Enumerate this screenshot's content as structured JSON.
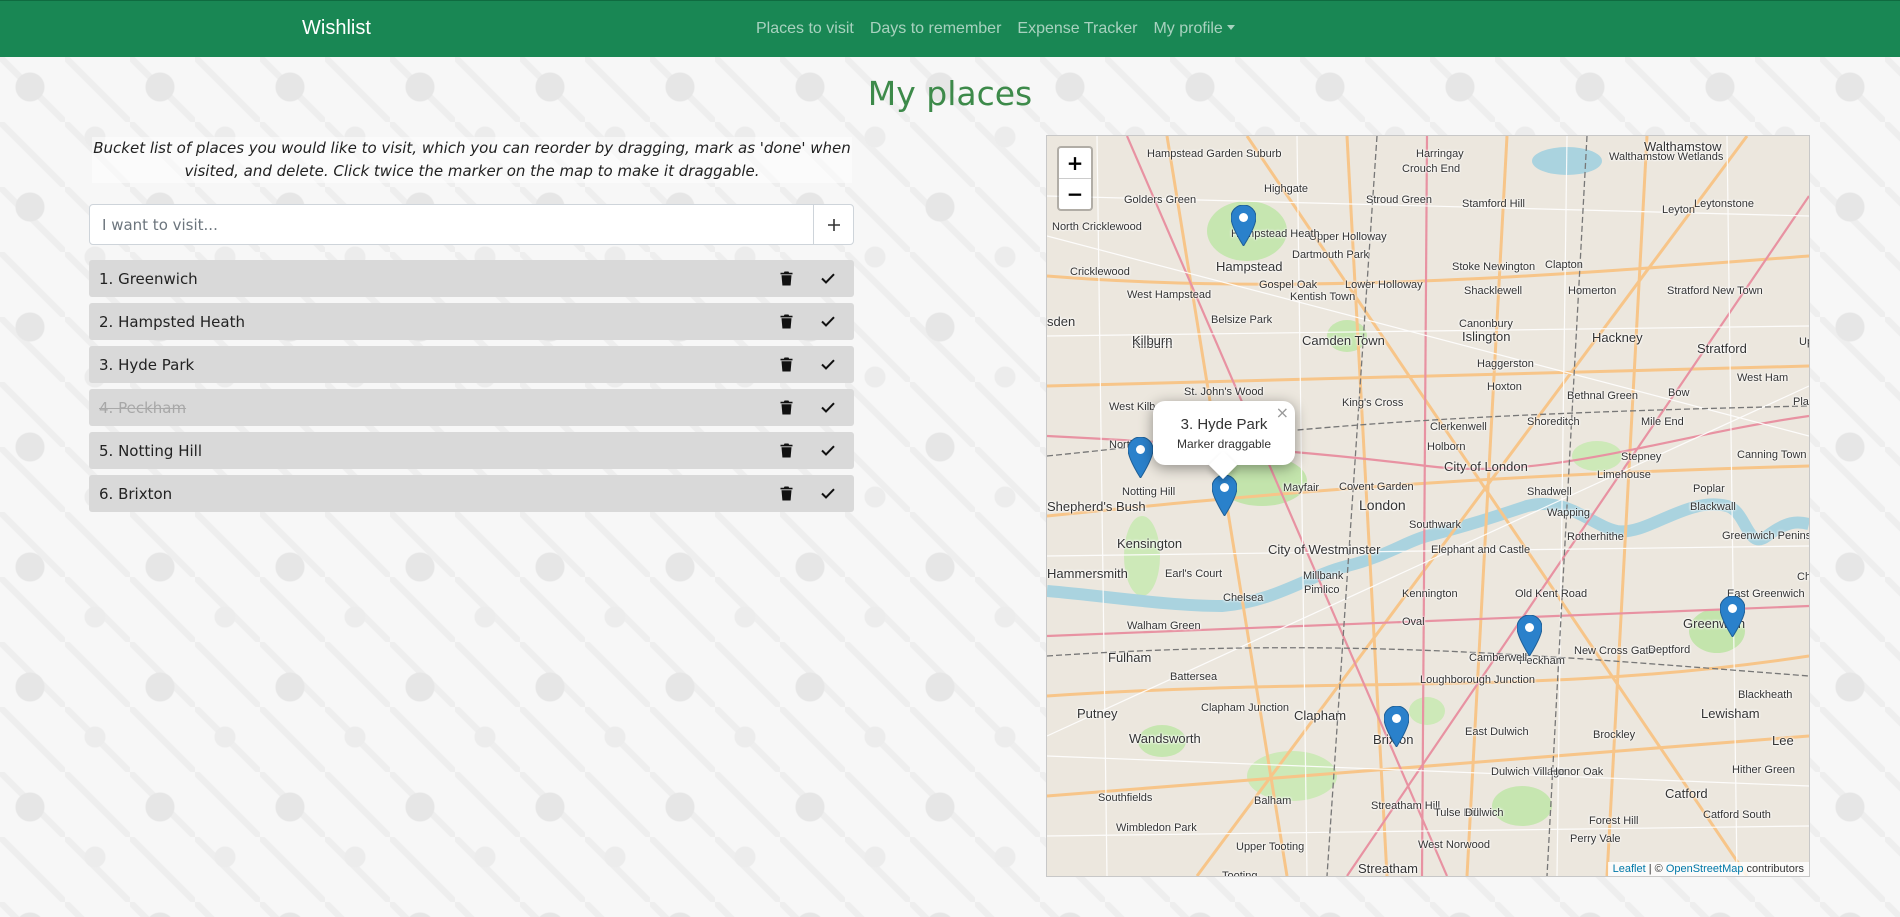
{
  "navbar": {
    "brand": "Wishlist",
    "links": [
      {
        "label": "Places to visit"
      },
      {
        "label": "Days to remember"
      },
      {
        "label": "Expense Tracker"
      },
      {
        "label": "My profile"
      }
    ],
    "color": "#198754"
  },
  "page": {
    "title": "My places",
    "description": "Bucket list of places you would like to visit, which you can reorder by dragging, mark as 'done' when visited, and delete. Click twice the marker on the map to make it draggable.",
    "title_color": "#3d8a4a"
  },
  "input": {
    "placeholder": "I want to visit...",
    "value": "",
    "add_icon": "plus-icon"
  },
  "places": [
    {
      "label": "1. Greenwich",
      "done": false
    },
    {
      "label": "2. Hampsted Heath",
      "done": false
    },
    {
      "label": "3. Hyde Park",
      "done": false
    },
    {
      "label": "4. Peckham",
      "done": true
    },
    {
      "label": "5. Notting Hill",
      "done": false
    },
    {
      "label": "6. Brixton",
      "done": false
    }
  ],
  "item_icons": {
    "delete": "trash-icon",
    "done": "check-icon"
  },
  "map": {
    "zoom_in": "+",
    "zoom_out": "−",
    "popup": {
      "title": "3. Hyde Park",
      "subtitle": "Marker draggable",
      "close": "×"
    },
    "attribution": {
      "leaflet": "Leaflet",
      "separator": " | © ",
      "osm": "OpenStreetMap",
      "suffix": " contributors"
    },
    "labels": [
      "Walthamstow",
      "Hampstead Garden Suburb",
      "Harringay",
      "Highgate",
      "Crouch End",
      "Golders Green",
      "Stroud Green",
      "Stamford Hill",
      "Leyton",
      "Leytonstone",
      "North Cricklewood",
      "Upper Holloway",
      "Hampstead",
      "Dartmouth Park",
      "Cricklewood",
      "Gospel Oak",
      "Lower Holloway",
      "Stoke Newington",
      "Clapton",
      "Kentish Town",
      "West Hampstead",
      "Shacklewell",
      "Homerton",
      "Stratford New Town",
      "Belsize Park",
      "Kilburn",
      "Camden Town",
      "Islington",
      "Canonbury",
      "Hackney",
      "Stratford",
      "Haggerston",
      "St. John's Wood",
      "Hoxton",
      "Bethnal Green",
      "Bow",
      "West Ham",
      "King's Cross",
      "Clerkenwell",
      "Shoreditch",
      "Mile End",
      "Holborn",
      "City of London",
      "Stepney",
      "Limehouse",
      "Canning Town",
      "Notting Hill",
      "Mayfair",
      "Covent Garden",
      "Shadwell",
      "Poplar",
      "Blackwall",
      "Shepherd's Bush",
      "London",
      "Southwark",
      "Wapping",
      "Kensington",
      "City of Westminster",
      "Elephant and Castle",
      "Rotherhithe",
      "Greenwich Peninsula",
      "Hammersmith",
      "Earl's Court",
      "Millbank",
      "Kennington",
      "Old Kent Road",
      "Chelsea",
      "Pimlico",
      "East Greenwich",
      "Walham Green",
      "Oval",
      "Greenwich",
      "Peckham",
      "New Cross Gate",
      "Deptford",
      "Fulham",
      "Camberwell",
      "Blackheath",
      "Battersea",
      "Loughborough Junction",
      "Putney",
      "Clapham Junction",
      "Clapham",
      "Lewisham",
      "Wandsworth",
      "Brixton",
      "East Dulwich",
      "Brockley",
      "Lee",
      "Dulwich Village",
      "Honor Oak",
      "Hither Green",
      "Southfields",
      "Balham",
      "Catford",
      "Wimbledon Park",
      "Streatham Hill",
      "Tulse Hill",
      "Dulwich",
      "Forest Hill",
      "Catford South",
      "Upper Tooting",
      "West Norwood",
      "Perry Vale",
      "Streatham",
      "Tooting",
      "Kilburn",
      "West Kilb",
      "Plaisto",
      "Walthamstow Wetlands",
      "Hampstead Heath",
      "sden",
      "North Kens",
      "Upt",
      "Cha"
    ]
  }
}
